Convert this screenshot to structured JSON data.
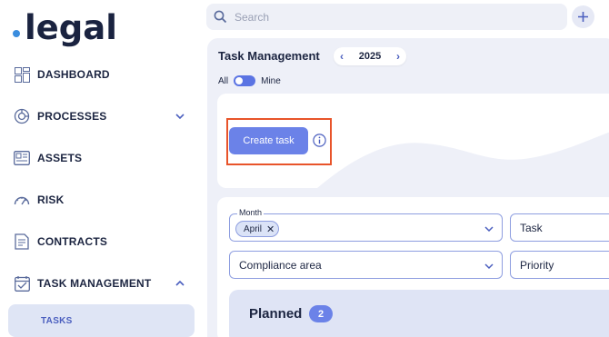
{
  "brand": {
    "name": "legal",
    "dot_color": "#3a8dde"
  },
  "sidebar": {
    "items": [
      {
        "label": "DASHBOARD",
        "icon": "dashboard-grid-icon"
      },
      {
        "label": "PROCESSES",
        "icon": "processes-icon",
        "expandable": true,
        "expanded": false
      },
      {
        "label": "ASSETS",
        "icon": "assets-icon"
      },
      {
        "label": "RISK",
        "icon": "risk-gauge-icon"
      },
      {
        "label": "CONTRACTS",
        "icon": "contracts-icon"
      },
      {
        "label": "TASK MANAGEMENT",
        "icon": "task-management-icon",
        "expandable": true,
        "expanded": true
      }
    ],
    "sub_items": [
      {
        "label": "TASKS",
        "active": true
      }
    ]
  },
  "search": {
    "placeholder": "Search",
    "value": ""
  },
  "header": {
    "add_icon": "plus-icon"
  },
  "main": {
    "title": "Task Management",
    "year": "2025",
    "toggle": {
      "left_label": "All",
      "right_label": "Mine",
      "state": "mine"
    },
    "create_task_label": "Create task",
    "filters": {
      "month": {
        "label": "Month",
        "selected": [
          "April"
        ]
      },
      "task": {
        "placeholder": "Task"
      },
      "compliance_area": {
        "placeholder": "Compliance area"
      },
      "priority": {
        "placeholder": "Priority"
      }
    },
    "planned": {
      "title": "Planned",
      "count": "2"
    }
  },
  "colors": {
    "accent": "#6b82e8",
    "highlight_frame": "#e8542a",
    "panel_bg": "#eef0f8"
  }
}
